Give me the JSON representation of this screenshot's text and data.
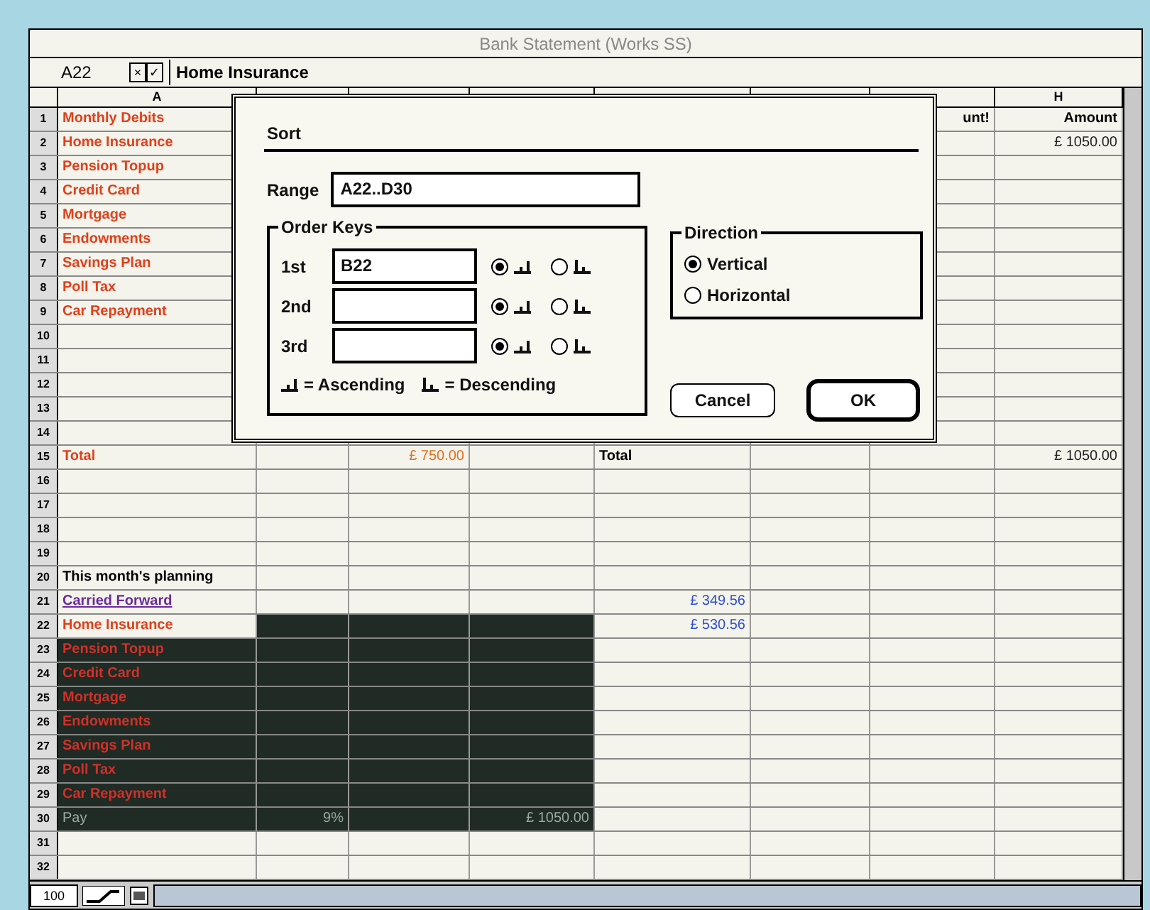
{
  "window": {
    "title": "Bank Statement (Works SS)"
  },
  "formula_bar": {
    "cell_ref": "A22",
    "cancel_mark": "×",
    "enter_mark": "✓",
    "value": "Home Insurance"
  },
  "columns": [
    {
      "letter": "A"
    },
    {
      "letter": "H"
    }
  ],
  "rows": [
    {
      "n": "1",
      "selected": false,
      "cells": {
        "A": {
          "text": "Monthly Debits",
          "kind": "debit"
        },
        "G": {
          "text": "unt!",
          "kind": "head-right"
        },
        "H": {
          "text": "Amount",
          "kind": "head-right"
        }
      }
    },
    {
      "n": "2",
      "selected": false,
      "cells": {
        "A": {
          "text": "Home Insurance",
          "kind": "debit"
        },
        "H": {
          "text": "£ 1050.00",
          "kind": "amount"
        }
      }
    },
    {
      "n": "3",
      "selected": false,
      "cells": {
        "A": {
          "text": "Pension Topup",
          "kind": "debit"
        }
      }
    },
    {
      "n": "4",
      "selected": false,
      "cells": {
        "A": {
          "text": "Credit Card",
          "kind": "debit"
        }
      }
    },
    {
      "n": "5",
      "selected": false,
      "cells": {
        "A": {
          "text": "Mortgage",
          "kind": "debit"
        }
      }
    },
    {
      "n": "6",
      "selected": false,
      "cells": {
        "A": {
          "text": "Endowments",
          "kind": "debit"
        }
      }
    },
    {
      "n": "7",
      "selected": false,
      "cells": {
        "A": {
          "text": "Savings Plan",
          "kind": "debit"
        }
      }
    },
    {
      "n": "8",
      "selected": false,
      "cells": {
        "A": {
          "text": "Poll Tax",
          "kind": "debit"
        }
      }
    },
    {
      "n": "9",
      "selected": false,
      "cells": {
        "A": {
          "text": "Car Repayment",
          "kind": "debit"
        }
      }
    },
    {
      "n": "10",
      "selected": false
    },
    {
      "n": "11",
      "selected": false
    },
    {
      "n": "12",
      "selected": false
    },
    {
      "n": "13",
      "selected": false
    },
    {
      "n": "14",
      "selected": false
    },
    {
      "n": "15",
      "selected": false,
      "cells": {
        "A": {
          "text": "Total",
          "kind": "debit"
        },
        "C": {
          "text": "£ 750.00",
          "kind": "total-amount"
        },
        "E": {
          "text": "Total",
          "kind": "heading"
        },
        "H": {
          "text": "£ 1050.00",
          "kind": "amount"
        }
      }
    },
    {
      "n": "16",
      "selected": false
    },
    {
      "n": "17",
      "selected": false
    },
    {
      "n": "18",
      "selected": false
    },
    {
      "n": "19",
      "selected": false
    },
    {
      "n": "20",
      "selected": false,
      "cells": {
        "A": {
          "text": "This month's planning",
          "kind": "heading"
        }
      }
    },
    {
      "n": "21",
      "selected": false,
      "cells": {
        "A": {
          "text": "Carried Forward",
          "kind": "carried"
        },
        "E": {
          "text": "£ 349.56",
          "kind": "blue-amount"
        }
      }
    },
    {
      "n": "22",
      "selected": true,
      "cells": {
        "A": {
          "text": "Home Insurance",
          "kind": "debit",
          "active": true
        },
        "E": {
          "text": "£ 530.56",
          "kind": "blue-amount"
        }
      }
    },
    {
      "n": "23",
      "selected": true,
      "cells": {
        "A": {
          "text": "Pension Topup",
          "kind": "debit"
        }
      }
    },
    {
      "n": "24",
      "selected": true,
      "cells": {
        "A": {
          "text": "Credit Card",
          "kind": "debit"
        }
      }
    },
    {
      "n": "25",
      "selected": true,
      "cells": {
        "A": {
          "text": "Mortgage",
          "kind": "debit"
        }
      }
    },
    {
      "n": "26",
      "selected": true,
      "cells": {
        "A": {
          "text": "Endowments",
          "kind": "debit"
        }
      }
    },
    {
      "n": "27",
      "selected": true,
      "cells": {
        "A": {
          "text": "Savings Plan",
          "kind": "debit"
        }
      }
    },
    {
      "n": "28",
      "selected": true,
      "cells": {
        "A": {
          "text": "Poll Tax",
          "kind": "debit"
        }
      }
    },
    {
      "n": "29",
      "selected": true,
      "cells": {
        "A": {
          "text": "Car Repayment",
          "kind": "debit"
        }
      }
    },
    {
      "n": "30",
      "selected": true,
      "cells": {
        "A": {
          "text": "Pay",
          "kind": "pay"
        },
        "B": {
          "text": "9%",
          "kind": "pay-right"
        },
        "D": {
          "text": "£ 1050.00",
          "kind": "pay-right"
        }
      }
    },
    {
      "n": "31",
      "selected": false
    },
    {
      "n": "32",
      "selected": false
    }
  ],
  "dialog": {
    "title": "Sort",
    "range_label": "Range",
    "range_value": "A22..D30",
    "order_keys": {
      "title": "Order Keys",
      "keys": [
        {
          "label": "1st",
          "value": "B22",
          "ascending": true
        },
        {
          "label": "2nd",
          "ascending": true
        },
        {
          "label": "3rd",
          "ascending": true
        }
      ],
      "legend_ascending": "= Ascending",
      "legend_descending": "= Descending"
    },
    "direction": {
      "title": "Direction",
      "options": [
        {
          "label": "Vertical",
          "selected": true
        },
        {
          "label": "Horizontal",
          "selected": false
        }
      ]
    },
    "buttons": [
      {
        "label": "Cancel",
        "default": false
      },
      {
        "label": "OK",
        "default": true
      }
    ]
  },
  "status_bar": {
    "zoom": "100"
  }
}
